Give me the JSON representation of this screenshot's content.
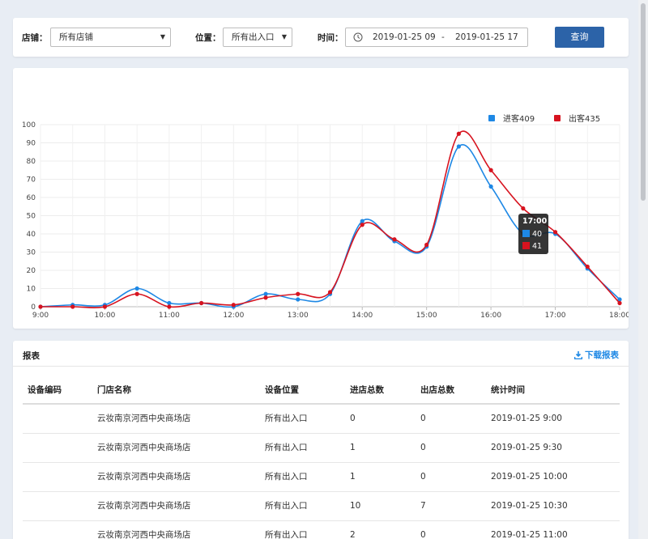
{
  "filters": {
    "store_label": "店铺：",
    "store_value": "所有店铺",
    "position_label": "位置：",
    "position_value": "所有出入口",
    "time_label": "时间：",
    "date_start": "2019-01-25 09",
    "date_sep": "-",
    "date_end": "2019-01-25 17",
    "query_button": "查询"
  },
  "chart_data": {
    "type": "line",
    "x_ticks": [
      "9:00",
      "10:00",
      "11:00",
      "12:00",
      "13:00",
      "14:00",
      "15:00",
      "16:00",
      "17:00",
      "18:00"
    ],
    "y_ticks": [
      0,
      10,
      20,
      30,
      40,
      50,
      60,
      70,
      80,
      90,
      100
    ],
    "ylim": [
      0,
      100
    ],
    "x_range_hours": [
      9,
      18
    ],
    "x": [
      9,
      9.5,
      10,
      10.5,
      11,
      11.5,
      12,
      12.5,
      13,
      13.5,
      14,
      14.5,
      15,
      15.5,
      16,
      16.5,
      17,
      17.5,
      18
    ],
    "series": [
      {
        "name": "进客409",
        "color": "#1e88e5",
        "values": [
          0,
          1,
          1,
          10,
          2,
          2,
          0,
          7,
          4,
          7,
          47,
          36,
          33,
          88,
          66,
          40,
          40,
          21,
          4
        ]
      },
      {
        "name": "出客435",
        "color": "#d7131f",
        "values": [
          0,
          0,
          0,
          7,
          0,
          2,
          1,
          5,
          7,
          8,
          45,
          37,
          34,
          95,
          75,
          54,
          41,
          22,
          2
        ]
      }
    ],
    "legend_position": "top-right",
    "grid": true,
    "tooltip": {
      "title": "17:00",
      "values": [
        "40",
        "41"
      ]
    }
  },
  "report": {
    "title": "报表",
    "download_label": "下载报表",
    "columns": [
      "设备编码",
      "门店名称",
      "设备位置",
      "进店总数",
      "出店总数",
      "统计时间"
    ],
    "rows": [
      [
        "",
        "云妆南京河西中央商场店",
        "所有出入口",
        "0",
        "0",
        "2019-01-25 9:00"
      ],
      [
        "",
        "云妆南京河西中央商场店",
        "所有出入口",
        "1",
        "0",
        "2019-01-25 9:30"
      ],
      [
        "",
        "云妆南京河西中央商场店",
        "所有出入口",
        "1",
        "0",
        "2019-01-25 10:00"
      ],
      [
        "",
        "云妆南京河西中央商场店",
        "所有出入口",
        "10",
        "7",
        "2019-01-25 10:30"
      ],
      [
        "",
        "云妆南京河西中央商场店",
        "所有出入口",
        "2",
        "0",
        "2019-01-25 11:00"
      ]
    ]
  },
  "colors": {
    "primary": "#2c63a8",
    "in_series": "#1e88e5",
    "out_series": "#d7131f",
    "link": "#1e88e5"
  }
}
